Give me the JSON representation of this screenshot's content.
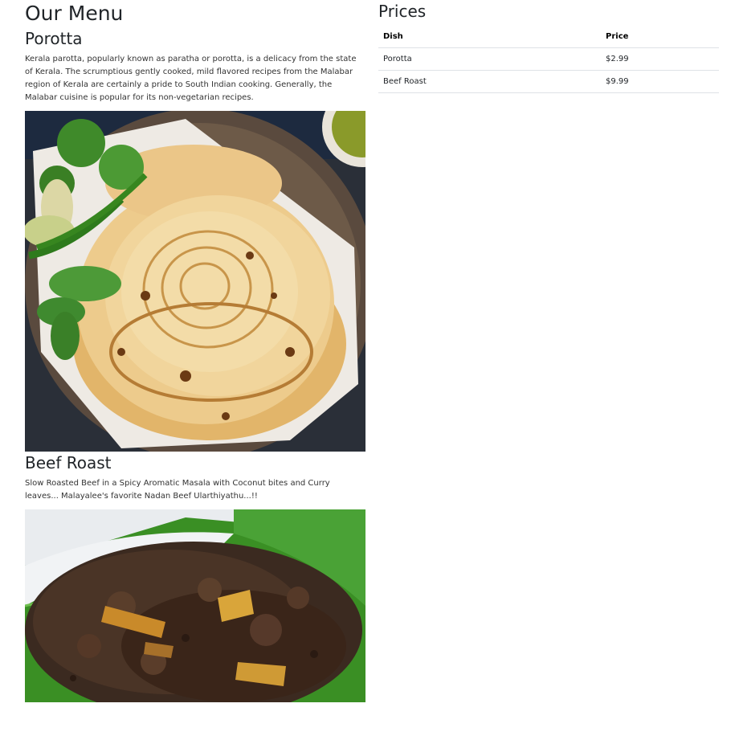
{
  "page": {
    "title": "Our Menu"
  },
  "menu": {
    "items": [
      {
        "name": "Porotta",
        "description": "Kerala parotta, popularly known as paratha or porotta, is a delicacy from the state of Kerala. The scrumptious gently cooked, mild flavored recipes from the Malabar region of Kerala are certainly a pride to South Indian cooking. Generally, the Malabar cuisine is popular for its non-vegetarian recipes.",
        "image_desc": "photo of layered porotta flatbreads on a plate with herbs and green chilies"
      },
      {
        "name": "Beef Roast",
        "description": "Slow Roasted Beef in a Spicy Aromatic Masala with Coconut bites and Curry leaves... Malayalee's favorite Nadan Beef Ularthiyathu...!!",
        "image_desc": "photo of dark beef roast with coconut pieces on a banana leaf"
      }
    ]
  },
  "prices": {
    "title": "Prices",
    "columns": [
      "Dish",
      "Price"
    ],
    "rows": [
      {
        "dish": "Porotta",
        "price": "$2.99"
      },
      {
        "dish": "Beef Roast",
        "price": "$9.99"
      }
    ]
  }
}
